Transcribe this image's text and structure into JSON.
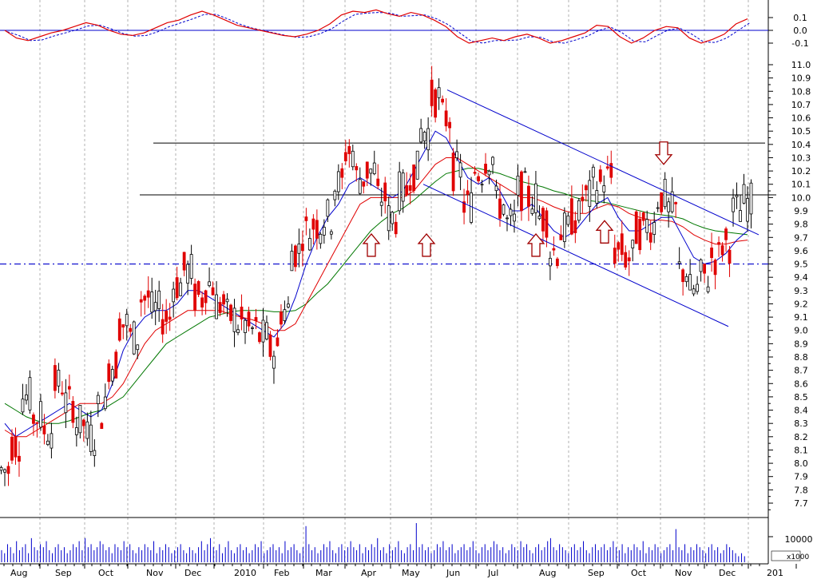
{
  "chart_data": {
    "type": "candlestick",
    "colors": {
      "up_candle": "#000000",
      "down_candle": "#e00000",
      "ma_short": "#0000cc",
      "ma_mid": "#e00000",
      "ma_long": "#007700",
      "channel": "#0000cc",
      "resistance": "#000000",
      "support": "#0000cc",
      "volume": "#0000cc",
      "oscillator": "#e00000",
      "oscillator_signal": "#0000cc",
      "arrow": "#a00000"
    },
    "x_axis": {
      "labels": [
        "Aug",
        "Sep",
        "Oct",
        "Nov",
        "Dec",
        "2010",
        "Feb",
        "Mar",
        "Apr",
        "May",
        "Jun",
        "Jul",
        "Aug",
        "Sep",
        "Oct",
        "Nov",
        "Dec",
        "201"
      ]
    },
    "oscillator": {
      "ylim": [
        -0.2,
        0.2
      ],
      "ticks": [
        "0.1",
        "0.0",
        "-0.1"
      ],
      "zero_line": 0.0,
      "series": [
        0.0,
        -0.06,
        -0.08,
        -0.05,
        -0.02,
        0.0,
        0.03,
        0.06,
        0.04,
        0.0,
        -0.03,
        -0.04,
        -0.02,
        0.02,
        0.06,
        0.08,
        0.12,
        0.15,
        0.12,
        0.08,
        0.04,
        0.02,
        0.0,
        -0.02,
        -0.04,
        -0.05,
        -0.03,
        0.0,
        0.05,
        0.12,
        0.15,
        0.14,
        0.16,
        0.13,
        0.11,
        0.14,
        0.12,
        0.08,
        0.03,
        -0.05,
        -0.1,
        -0.08,
        -0.06,
        -0.08,
        -0.05,
        -0.03,
        -0.06,
        -0.1,
        -0.08,
        -0.05,
        -0.02,
        0.04,
        0.03,
        -0.05,
        -0.1,
        -0.06,
        0.0,
        0.03,
        0.02,
        -0.06,
        -0.1,
        -0.07,
        -0.03,
        0.05,
        0.09
      ]
    },
    "price": {
      "ylim": [
        7.6,
        11.1
      ],
      "ticks": [
        "11.0",
        "10.9",
        "10.8",
        "10.7",
        "10.6",
        "10.5",
        "10.4",
        "10.3",
        "10.2",
        "10.1",
        "10.0",
        "9.9",
        "9.8",
        "9.7",
        "9.6",
        "9.5",
        "9.4",
        "9.3",
        "9.2",
        "9.1",
        "9.0",
        "8.9",
        "8.8",
        "8.7",
        "8.6",
        "8.5",
        "8.4",
        "8.3",
        "8.2",
        "8.1",
        "8.0",
        "7.9",
        "7.8",
        "7.7"
      ],
      "close": [
        7.95,
        8.15,
        8.5,
        8.35,
        8.25,
        8.6,
        8.45,
        8.3,
        8.2,
        8.4,
        8.75,
        9.05,
        8.95,
        9.25,
        9.15,
        9.1,
        9.35,
        9.45,
        9.25,
        9.35,
        9.2,
        9.1,
        9.05,
        9.0,
        8.95,
        8.85,
        9.15,
        9.6,
        9.75,
        9.8,
        9.85,
        10.1,
        10.35,
        10.15,
        10.2,
        10.0,
        9.85,
        10.05,
        10.2,
        10.5,
        10.75,
        10.6,
        10.2,
        9.95,
        10.2,
        10.3,
        9.95,
        9.8,
        10.05,
        10.0,
        9.85,
        9.6,
        9.75,
        9.85,
        10.0,
        10.1,
        10.15,
        9.6,
        9.55,
        9.75,
        9.8,
        10.0,
        9.9,
        9.45,
        9.3,
        9.4,
        9.55,
        9.65,
        9.9,
        9.97
      ],
      "ma_short": [
        8.3,
        8.2,
        8.25,
        8.3,
        8.35,
        8.4,
        8.45,
        8.4,
        8.35,
        8.4,
        8.6,
        8.85,
        9.0,
        9.1,
        9.15,
        9.15,
        9.2,
        9.3,
        9.3,
        9.25,
        9.2,
        9.15,
        9.1,
        9.05,
        9.0,
        8.95,
        9.05,
        9.25,
        9.5,
        9.7,
        9.85,
        9.95,
        10.1,
        10.15,
        10.1,
        10.05,
        10.0,
        10.05,
        10.2,
        10.35,
        10.5,
        10.45,
        10.3,
        10.15,
        10.1,
        10.15,
        10.05,
        9.9,
        9.9,
        9.95,
        9.85,
        9.75,
        9.7,
        9.75,
        9.85,
        9.95,
        10.0,
        9.85,
        9.75,
        9.75,
        9.8,
        9.85,
        9.85,
        9.7,
        9.55,
        9.5,
        9.52,
        9.58,
        9.68,
        9.75
      ],
      "ma_mid": [
        8.25,
        8.2,
        8.2,
        8.25,
        8.3,
        8.35,
        8.4,
        8.45,
        8.45,
        8.45,
        8.5,
        8.6,
        8.75,
        8.9,
        9.0,
        9.05,
        9.1,
        9.15,
        9.15,
        9.15,
        9.15,
        9.12,
        9.1,
        9.08,
        9.05,
        9.0,
        9.0,
        9.05,
        9.2,
        9.35,
        9.5,
        9.65,
        9.8,
        9.95,
        10.0,
        10.0,
        10.0,
        10.0,
        10.05,
        10.15,
        10.25,
        10.3,
        10.3,
        10.25,
        10.2,
        10.15,
        10.1,
        10.05,
        10.0,
        10.0,
        9.97,
        9.93,
        9.9,
        9.88,
        9.88,
        9.92,
        9.95,
        9.93,
        9.88,
        9.85,
        9.83,
        9.83,
        9.82,
        9.78,
        9.72,
        9.68,
        9.65,
        9.65,
        9.67,
        9.68
      ],
      "ma_long": [
        8.45,
        8.4,
        8.35,
        8.32,
        8.3,
        8.3,
        8.32,
        8.35,
        8.38,
        8.4,
        8.45,
        8.5,
        8.6,
        8.7,
        8.8,
        8.9,
        8.95,
        9.0,
        9.05,
        9.1,
        9.12,
        9.14,
        9.15,
        9.15,
        9.15,
        9.14,
        9.14,
        9.15,
        9.2,
        9.28,
        9.35,
        9.45,
        9.55,
        9.65,
        9.75,
        9.82,
        9.88,
        9.92,
        9.98,
        10.05,
        10.12,
        10.18,
        10.2,
        10.22,
        10.22,
        10.2,
        10.18,
        10.15,
        10.12,
        10.1,
        10.08,
        10.05,
        10.03,
        10.0,
        9.98,
        9.97,
        9.96,
        9.94,
        9.92,
        9.9,
        9.88,
        9.87,
        9.86,
        9.84,
        9.8,
        9.77,
        9.75,
        9.74,
        9.73,
        9.72
      ]
    },
    "lines": {
      "resistance_upper": 10.41,
      "resistance_lower": 10.02,
      "support_dashed": 9.5,
      "channel_upper": [
        [
          10.81,
          9.72
        ]
      ],
      "channel_lower": [
        [
          10.1,
          9.03
        ]
      ]
    },
    "arrows": {
      "up": [
        9.75,
        9.75,
        9.75,
        9.85
      ],
      "down": [
        10.28
      ]
    },
    "volume": {
      "tick_label": "10000",
      "unit_label": "x1000",
      "values": [
        4,
        3,
        6,
        5,
        3,
        7,
        4,
        5,
        6,
        3,
        8,
        5,
        4,
        6,
        5,
        7,
        4,
        3,
        5,
        6,
        4,
        5,
        3,
        4,
        6,
        5,
        7,
        4,
        8,
        5,
        6,
        4,
        5,
        7,
        6,
        4,
        5,
        3,
        6,
        5,
        4,
        7,
        5,
        6,
        4,
        3,
        5,
        4,
        6,
        5,
        4,
        7,
        3,
        5,
        4,
        6,
        5,
        3,
        4,
        5,
        6,
        4,
        3,
        5,
        4,
        3,
        5,
        7,
        4,
        6,
        8,
        5,
        4,
        6,
        3,
        5,
        7,
        4,
        3,
        5,
        6,
        4,
        5,
        3,
        4,
        6,
        5,
        7,
        3,
        4,
        5,
        6,
        4,
        5,
        3,
        7,
        4,
        5,
        6,
        4,
        3,
        5,
        12,
        6,
        4,
        5,
        3,
        4,
        6,
        5,
        7,
        4,
        3,
        5,
        6,
        4,
        5,
        7,
        5,
        4,
        6,
        3,
        5,
        4,
        6,
        5,
        8,
        4,
        5,
        3,
        6,
        4,
        5,
        7,
        4,
        3,
        5,
        6,
        4,
        13,
        5,
        6,
        4,
        5,
        3,
        4,
        6,
        5,
        7,
        4,
        5,
        6,
        3,
        4,
        5,
        6,
        4,
        5,
        7,
        4,
        3,
        5,
        6,
        4,
        5,
        7,
        6,
        4,
        5,
        3,
        4,
        6,
        5,
        4,
        7,
        5,
        6,
        4,
        3,
        5,
        6,
        4,
        5,
        7,
        8,
        5,
        4,
        6,
        5,
        4,
        3,
        5,
        6,
        4,
        5,
        7,
        4,
        3,
        5,
        6,
        4,
        5,
        6,
        4,
        5,
        7,
        5,
        4,
        6,
        3,
        5,
        4,
        6,
        5,
        4,
        7,
        3,
        5,
        4,
        6,
        5,
        3,
        4,
        5,
        6,
        4,
        11,
        5,
        4,
        6,
        3,
        5,
        4,
        6,
        5,
        4,
        3,
        5,
        6,
        4,
        5,
        3,
        4,
        6,
        5,
        4,
        3,
        2,
        3,
        2
      ]
    }
  }
}
